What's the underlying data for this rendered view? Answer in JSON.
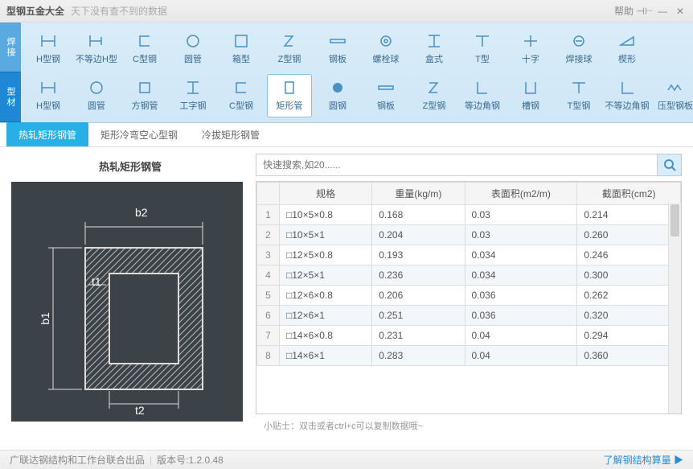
{
  "app": {
    "title": "型钢五金大全",
    "subtitle": "天下没有查不到的数据",
    "help": "帮助"
  },
  "sideTabs": [
    "焊接",
    "型材"
  ],
  "row1": [
    {
      "label": "H型钢",
      "icon": "H"
    },
    {
      "label": "不等边H型",
      "icon": "H2"
    },
    {
      "label": "C型钢",
      "icon": "C"
    },
    {
      "label": "圆管",
      "icon": "O"
    },
    {
      "label": "箱型",
      "icon": "box"
    },
    {
      "label": "Z型钢",
      "icon": "Z"
    },
    {
      "label": "钢板",
      "icon": "plate"
    },
    {
      "label": "螺栓球",
      "icon": "bolt"
    },
    {
      "label": "盒式",
      "icon": "I2"
    },
    {
      "label": "T型",
      "icon": "T"
    },
    {
      "label": "十字",
      "icon": "cross"
    },
    {
      "label": "焊接球",
      "icon": "weld"
    },
    {
      "label": "楔形",
      "icon": "wedge"
    }
  ],
  "row2": [
    {
      "label": "H型钢",
      "icon": "H"
    },
    {
      "label": "圆管",
      "icon": "O"
    },
    {
      "label": "方钢管",
      "icon": "sq"
    },
    {
      "label": "工字钢",
      "icon": "I"
    },
    {
      "label": "C型钢",
      "icon": "C"
    },
    {
      "label": "矩形管",
      "icon": "rect",
      "active": true
    },
    {
      "label": "圆钢",
      "icon": "disc"
    },
    {
      "label": "钢板",
      "icon": "plate"
    },
    {
      "label": "Z型钢",
      "icon": "Z"
    },
    {
      "label": "等边角钢",
      "icon": "L"
    },
    {
      "label": "槽钢",
      "icon": "U"
    },
    {
      "label": "T型钢",
      "icon": "T"
    },
    {
      "label": "不等边角钢",
      "icon": "L2"
    },
    {
      "label": "压型钢板",
      "icon": "corr"
    }
  ],
  "subTabs": [
    "热轧矩形钢管",
    "矩形冷弯空心型钢",
    "冷拔矩形钢管"
  ],
  "panelTitle": "热轧矩形钢管",
  "diagram": {
    "b1": "b1",
    "b2": "b2",
    "t1": "t1",
    "t2": "t2"
  },
  "search": {
    "placeholder": "快速搜索,如20......"
  },
  "columns": [
    "规格",
    "重量(kg/m)",
    "表面积(m2/m)",
    "截面积(cm2)"
  ],
  "rows": [
    {
      "n": "1",
      "spec": "□10×5×0.8",
      "w": "0.168",
      "sa": "0.03",
      "ca": "0.214"
    },
    {
      "n": "2",
      "spec": "□10×5×1",
      "w": "0.204",
      "sa": "0.03",
      "ca": "0.260"
    },
    {
      "n": "3",
      "spec": "□12×5×0.8",
      "w": "0.193",
      "sa": "0.034",
      "ca": "0.246"
    },
    {
      "n": "4",
      "spec": "□12×5×1",
      "w": "0.236",
      "sa": "0.034",
      "ca": "0.300"
    },
    {
      "n": "5",
      "spec": "□12×6×0.8",
      "w": "0.206",
      "sa": "0.036",
      "ca": "0.262"
    },
    {
      "n": "6",
      "spec": "□12×6×1",
      "w": "0.251",
      "sa": "0.036",
      "ca": "0.320"
    },
    {
      "n": "7",
      "spec": "□14×6×0.8",
      "w": "0.231",
      "sa": "0.04",
      "ca": "0.294"
    },
    {
      "n": "8",
      "spec": "□14×6×1",
      "w": "0.283",
      "sa": "0.04",
      "ca": "0.360"
    }
  ],
  "tip": "小贴士：双击或者ctrl+c可以复制数据哦~",
  "footer": {
    "left": "广联达钢结构和工作台联合出品",
    "ver": "版本号:1.2.0.48",
    "right": "了解钢结构算量",
    "arrow": "▶"
  }
}
